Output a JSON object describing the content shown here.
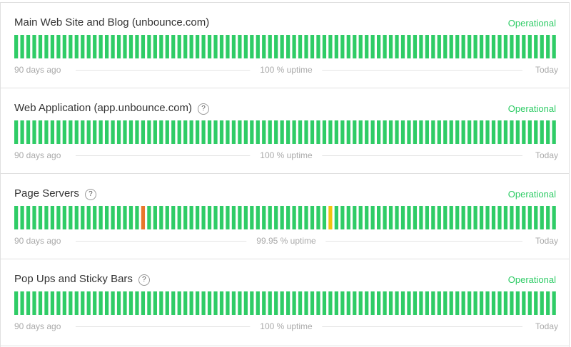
{
  "colors": {
    "operational": "#2fcc66",
    "bar_up": "#2fcc66",
    "bar_major": "#e8762b",
    "bar_minor": "#f1c40f",
    "muted": "#aaaaaa"
  },
  "components": [
    {
      "name": "Main Web Site and Blog (unbounce.com)",
      "has_help": false,
      "status": "Operational",
      "days": 90,
      "incidents": [],
      "left_label": "90 days ago",
      "uptime": "100 % uptime",
      "right_label": "Today"
    },
    {
      "name": "Web Application (app.unbounce.com)",
      "has_help": true,
      "help": "?",
      "status": "Operational",
      "days": 90,
      "incidents": [],
      "left_label": "90 days ago",
      "uptime": "100 % uptime",
      "right_label": "Today"
    },
    {
      "name": "Page Servers",
      "has_help": true,
      "help": "?",
      "status": "Operational",
      "days": 90,
      "incidents": [
        {
          "day": 21,
          "level": "major"
        },
        {
          "day": 52,
          "level": "minor"
        }
      ],
      "left_label": "90 days ago",
      "uptime": "99.95 % uptime",
      "right_label": "Today"
    },
    {
      "name": "Pop Ups and Sticky Bars",
      "has_help": true,
      "help": "?",
      "status": "Operational",
      "days": 90,
      "incidents": [],
      "left_label": "90 days ago",
      "uptime": "100 % uptime",
      "right_label": "Today"
    }
  ]
}
